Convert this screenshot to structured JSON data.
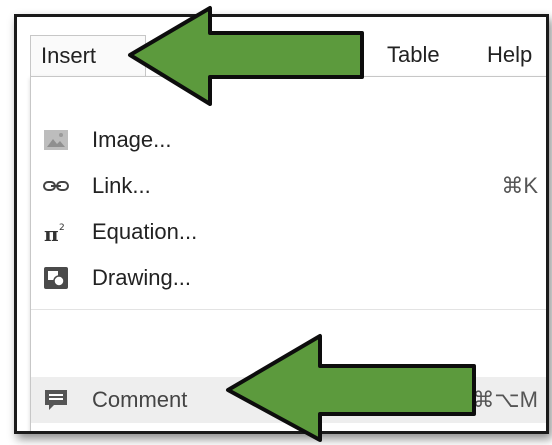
{
  "menubar": {
    "items": [
      {
        "label": "Insert"
      },
      {
        "label": "Table"
      },
      {
        "label": "Help"
      }
    ]
  },
  "insert_menu": {
    "items": [
      {
        "label": "Image...",
        "icon": "image-icon",
        "shortcut": ""
      },
      {
        "label": "Link...",
        "icon": "link-icon",
        "shortcut": "⌘K"
      },
      {
        "label": "Equation...",
        "icon": "equation-icon",
        "shortcut": ""
      },
      {
        "label": "Drawing...",
        "icon": "drawing-icon",
        "shortcut": ""
      },
      {
        "label": "Comment",
        "icon": "comment-icon",
        "shortcut": "⌘⌥M"
      }
    ]
  },
  "annotations": {
    "arrow_color": "#5c9a3d",
    "arrow_outline": "#0d0d0d"
  }
}
